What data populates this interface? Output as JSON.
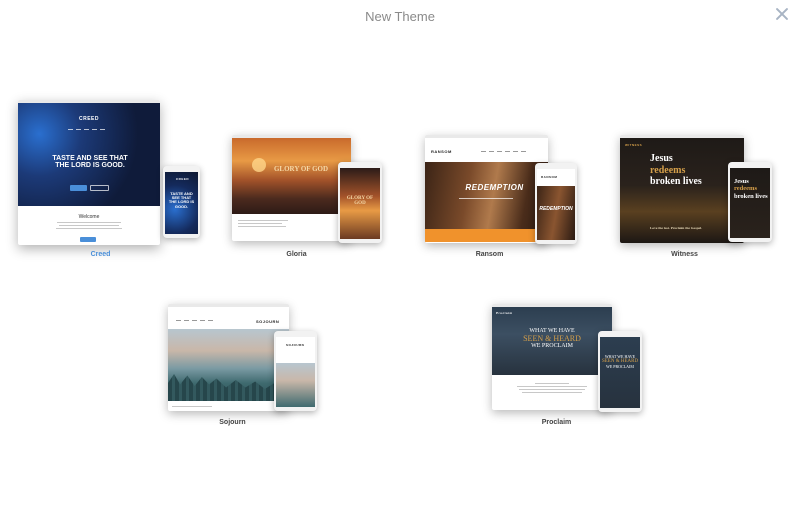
{
  "dialog": {
    "title": "New Theme"
  },
  "themes": [
    {
      "name": "Creed",
      "selected": true,
      "logo": "CREED",
      "headline": "TASTE AND SEE THAT THE LORD IS GOOD.",
      "welcome": "Welcome",
      "accent": "#4a8fd9"
    },
    {
      "name": "Gloria",
      "selected": false,
      "headline": "GLORY OF GOD"
    },
    {
      "name": "Ransom",
      "selected": false,
      "logo": "RANSOM",
      "headline": "REDEMPTION"
    },
    {
      "name": "Witness",
      "selected": false,
      "logo": "WITNESS",
      "headline_1": "Jesus",
      "headline_2": "redeems",
      "headline_3": "broken lives",
      "tagline": "Love the lost. Proclaim the Gospel.",
      "accent": "#d6a04a"
    },
    {
      "name": "Sojourn",
      "selected": false,
      "logo": "SOJOURN"
    },
    {
      "name": "Proclaim",
      "selected": false,
      "logo": "Proclaim",
      "headline_1": "WHAT WE HAVE",
      "headline_2": "SEEN & HEARD",
      "headline_3": "WE PROCLAIM",
      "accent": "#d6a04a"
    }
  ]
}
